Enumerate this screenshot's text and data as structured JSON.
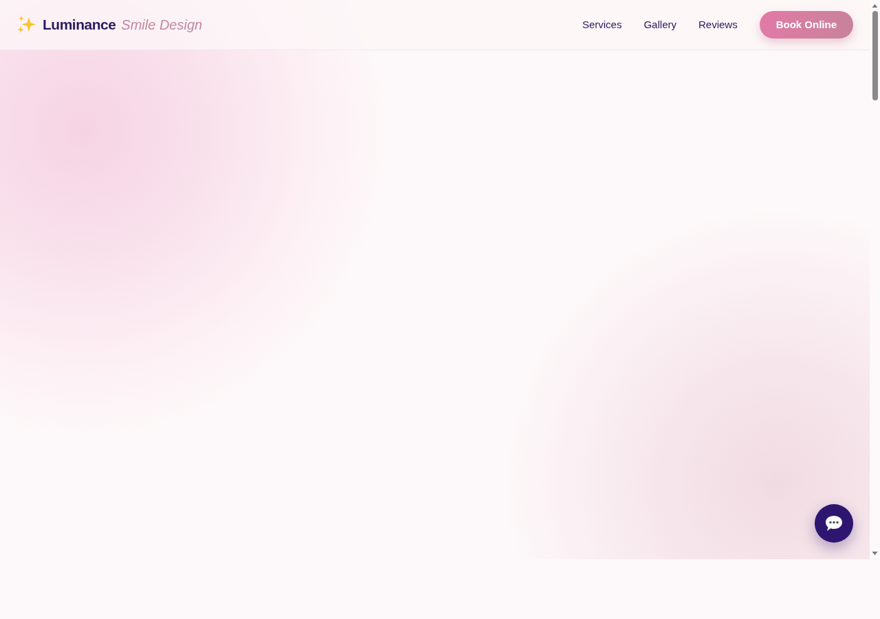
{
  "brand": {
    "name": "Luminance",
    "tagline": "Smile Design"
  },
  "nav": [
    {
      "label": "Services"
    },
    {
      "label": "Gallery"
    },
    {
      "label": "Reviews"
    }
  ],
  "cta": {
    "label": "Book Online"
  }
}
